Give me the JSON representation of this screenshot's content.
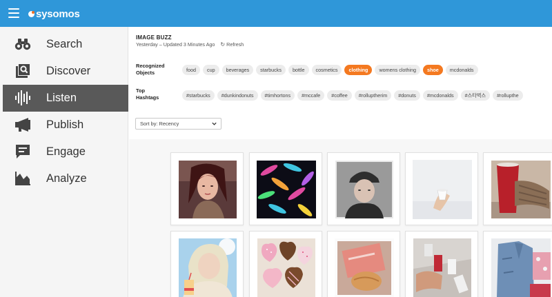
{
  "app": {
    "brand": "sysomos",
    "brand_accent": "#f36f21",
    "topbar_color": "#2f97d9"
  },
  "sidebar": {
    "items": [
      {
        "label": "Search",
        "icon": "binoculars-icon",
        "active": false
      },
      {
        "label": "Discover",
        "icon": "discover-icon",
        "active": false
      },
      {
        "label": "Listen",
        "icon": "soundwave-icon",
        "active": true
      },
      {
        "label": "Publish",
        "icon": "megaphone-icon",
        "active": false
      },
      {
        "label": "Engage",
        "icon": "chat-icon",
        "active": false
      },
      {
        "label": "Analyze",
        "icon": "area-chart-icon",
        "active": false
      }
    ]
  },
  "buzz": {
    "title": "IMAGE BUZZ",
    "subtitle": "Yesterday – Updated 3 Minutes Ago",
    "refresh_label": "Refresh"
  },
  "objects": {
    "label_line1": "Recognized",
    "label_line2": "Objects",
    "tags": [
      {
        "text": "food",
        "selected": false
      },
      {
        "text": "cup",
        "selected": false
      },
      {
        "text": "beverages",
        "selected": false
      },
      {
        "text": "starbucks",
        "selected": false
      },
      {
        "text": "bottle",
        "selected": false
      },
      {
        "text": "cosmetics",
        "selected": false
      },
      {
        "text": "clothing",
        "selected": true
      },
      {
        "text": "womens clothing",
        "selected": false
      },
      {
        "text": "shoe",
        "selected": true
      },
      {
        "text": "mcdonalds",
        "selected": false
      }
    ]
  },
  "hashtags": {
    "label_line1": "Top",
    "label_line2": "Hashtags",
    "tags": [
      {
        "text": "#starbucks"
      },
      {
        "text": "#dunkindonuts"
      },
      {
        "text": "#timhortons"
      },
      {
        "text": "#mccafe"
      },
      {
        "text": "#coffee"
      },
      {
        "text": "#rolluptherim"
      },
      {
        "text": "#donuts"
      },
      {
        "text": "#mcdonalds"
      },
      {
        "text": "#스타벅스"
      },
      {
        "text": "#rollupthe"
      }
    ]
  },
  "sort": {
    "value": "Sort by: Recency"
  },
  "gallery": {
    "images": [
      {
        "name": "photo-woman-red-hair-portrait"
      },
      {
        "name": "photo-colorful-feathers-pattern"
      },
      {
        "name": "photo-person-cap-selfie"
      },
      {
        "name": "photo-hand-holding-small-cup"
      },
      {
        "name": "photo-red-cup-knit-sleeve"
      },
      {
        "name": "photo-girl-with-drink-selfie"
      },
      {
        "name": "photo-heart-donuts"
      },
      {
        "name": "photo-pink-bag-pastry"
      },
      {
        "name": "photo-cups-on-floor"
      },
      {
        "name": "photo-denim-jacket-flatlay"
      }
    ]
  }
}
